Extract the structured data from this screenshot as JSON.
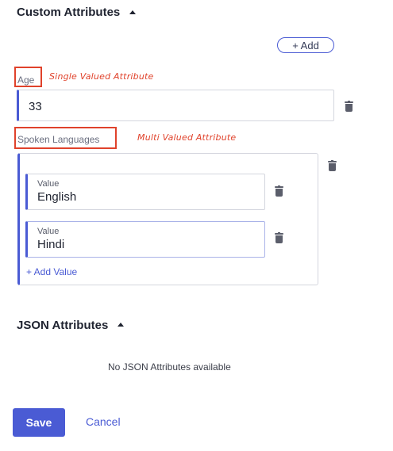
{
  "custom_attributes": {
    "title": "Custom Attributes",
    "add_label": "+ Add",
    "age": {
      "label": "Age",
      "annotation": "Single Valued Attribute",
      "value": "33"
    },
    "spoken_languages": {
      "label": "Spoken Languages",
      "annotation": "Multi Valued Attribute",
      "values": [
        {
          "tag": "Value",
          "value": "English"
        },
        {
          "tag": "Value",
          "value": "Hindi"
        }
      ],
      "add_value_label": "+ Add Value"
    }
  },
  "json_attributes": {
    "title": "JSON Attributes",
    "empty_message": "No JSON Attributes available"
  },
  "actions": {
    "save_label": "Save",
    "cancel_label": "Cancel"
  },
  "colors": {
    "accent": "#4a5bd4",
    "annotation": "#e0422b"
  }
}
